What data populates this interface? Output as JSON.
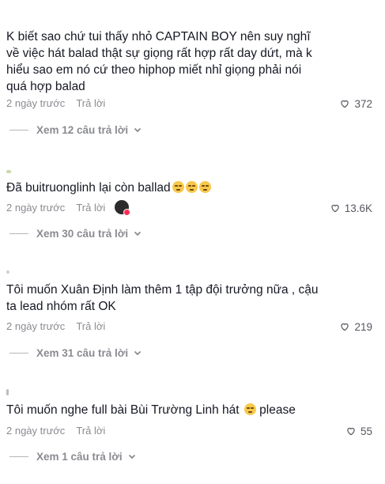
{
  "comments": [
    {
      "text": "K biết sao chứ tui thấy nhỏ CAPTAIN BOY nên suy nghĩ về việc hát balad thật sự giọng rất hợp rất day dứt, mà k hiểu sao em nó cứ theo hiphop miết nhỉ giọng phải nói quá hợp balad",
      "time": "2 ngày trước",
      "reply_label": "Trả lời",
      "likes": "372",
      "view_replies": "Xem 12 câu trả lời"
    },
    {
      "text": "Đã buitruonglinh lại còn ballad",
      "time": "2 ngày trước",
      "reply_label": "Trả lời",
      "likes": "13.6K",
      "view_replies": "Xem 30 câu trả lời"
    },
    {
      "text": "Tôi muốn Xuân Định làm thêm 1 tập đội trưởng nữa , cậu ta lead nhóm rất OK",
      "time": "2 ngày trước",
      "reply_label": "Trả lời",
      "likes": "219",
      "view_replies": "Xem 31 câu trả lời"
    },
    {
      "text": "Tôi muốn nghe full bài Bùi Trường Linh hát",
      "text_suffix": "please",
      "time": "2 ngày trước",
      "reply_label": "Trả lời",
      "likes": "55",
      "view_replies": "Xem 1 câu trả lời"
    }
  ],
  "icons": {
    "like": "heart-outline-icon",
    "expand": "chevron-down-icon",
    "emoji": "pensive-face-emoji"
  },
  "colors": {
    "text": "#161823",
    "muted": "#8a8b91",
    "accent": "#fe2c55"
  }
}
